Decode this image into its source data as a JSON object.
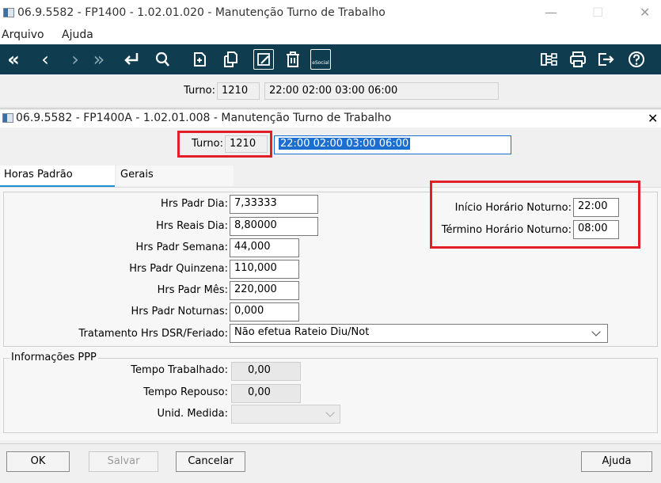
{
  "outer_window": {
    "title": "06.9.5582 - FP1400 - 1.02.01.020 - Manutenção Turno de Trabalho",
    "menu": [
      "Arquivo",
      "Ajuda"
    ],
    "controls": {
      "minimize": "—",
      "maximize": "☐",
      "close": "✕"
    }
  },
  "toolbar": {
    "buttons": [
      "first-icon",
      "previous-icon",
      "next-icon",
      "last-icon",
      "return-icon",
      "search-icon",
      "new-record-icon",
      "copy-icon",
      "edit-icon",
      "delete-icon",
      "esocial-icon",
      "hierarchy-icon",
      "print-icon",
      "exit-icon",
      "help-icon"
    ],
    "esocial_label": "eSocial",
    "background": "#0f3d4f"
  },
  "outer_turno": {
    "label": "Turno:",
    "value": "1210",
    "schedule": "22:00 02:00 03:00 06:00"
  },
  "inner_window": {
    "title": "06.9.5582 - FP1400A - 1.02.01.008 - Manutenção Turno de Trabalho",
    "close": "✕",
    "turno": {
      "label": "Turno:",
      "value": "1210",
      "schedule": "22:00 02:00 03:00 06:00"
    },
    "tabs": [
      {
        "label": "Horas Padrão",
        "active": true
      },
      {
        "label": "Gerais",
        "active": false
      }
    ],
    "fields": [
      {
        "label": "Hrs Padr Dia:",
        "value": "7,33333"
      },
      {
        "label": "Hrs Reais Dia:",
        "value": "8,80000"
      },
      {
        "label": "Hrs Padr Semana:",
        "value": "44,000"
      },
      {
        "label": "Hrs Padr Quinzena:",
        "value": "110,000"
      },
      {
        "label": "Hrs Padr Mês:",
        "value": "220,000"
      },
      {
        "label": "Hrs Padr Noturnas:",
        "value": "0,000"
      }
    ],
    "night": [
      {
        "label": "Início Horário Noturno:",
        "value": "22:00"
      },
      {
        "label": "Término Horário Noturno:",
        "value": "08:00"
      }
    ],
    "dsr": {
      "label": "Tratamento Hrs DSR/Feriado:",
      "value": "Não efetua Rateio Diu/Not"
    },
    "ppp": {
      "title": "Informações PPP",
      "tempo_trabalhado": {
        "label": "Tempo Trabalhado:",
        "value": "0,00"
      },
      "tempo_repouso": {
        "label": "Tempo Repouso:",
        "value": "0,00"
      },
      "unid_medida": {
        "label": "Unid. Medida:",
        "value": ""
      }
    },
    "buttons": {
      "ok": "OK",
      "salvar": "Salvar",
      "cancelar": "Cancelar",
      "ajuda": "Ajuda"
    }
  },
  "colors": {
    "highlight": "#e01f26",
    "selection": "#1c6fd1",
    "tab_accent": "#1c8fd1"
  }
}
